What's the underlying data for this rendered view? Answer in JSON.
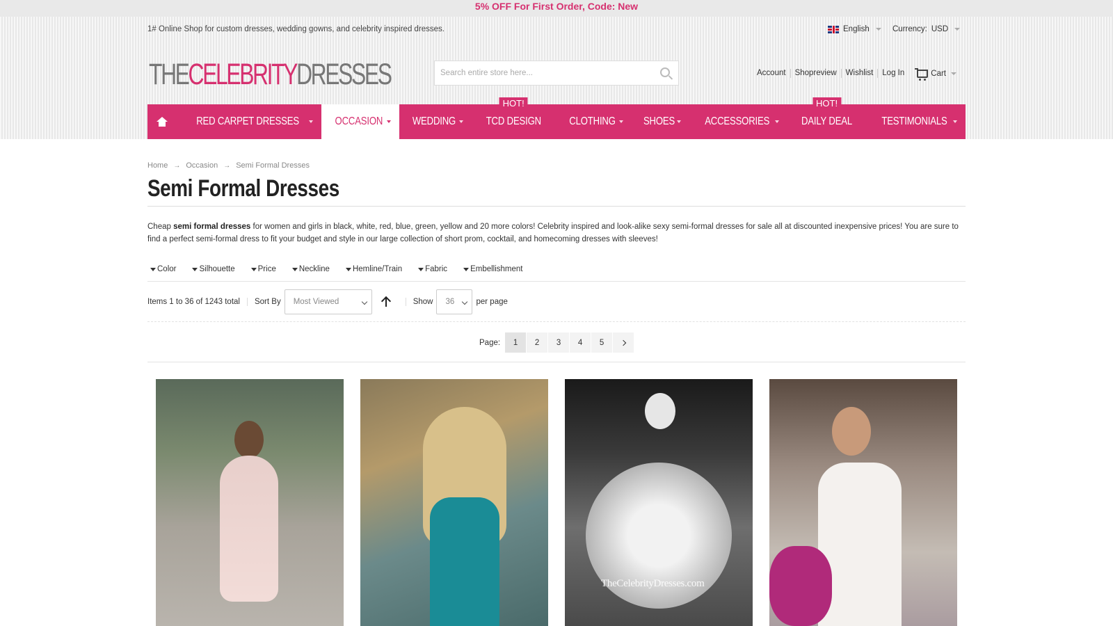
{
  "promo": "5% OFF For First Order, Code: New",
  "tagline": "1# Online Shop for custom dresses, wedding gowns, and celebrity inspired dresses.",
  "language": "English",
  "currency": {
    "label": "Currency:",
    "value": "USD"
  },
  "logo": {
    "part1": "THE",
    "part2": "CELEBRITY",
    "part3": "DRESSES"
  },
  "search": {
    "placeholder": "Search entire store here..."
  },
  "toplinks": [
    "Account",
    "Shopreview",
    "Wishlist",
    "Log In"
  ],
  "cart_label": "Cart",
  "nav": {
    "items": [
      {
        "label": "RED CARPET DRESSES"
      },
      {
        "label": "OCCASION"
      },
      {
        "label": "WEDDING"
      },
      {
        "label": "TCD DESIGN",
        "badge": "Hot!"
      },
      {
        "label": "CLOTHING"
      },
      {
        "label": "SHOES"
      },
      {
        "label": "ACCESSORIES"
      },
      {
        "label": "DAILY DEAL",
        "badge": "Hot!"
      },
      {
        "label": "TESTIMONIALS"
      }
    ]
  },
  "breadcrumb": [
    "Home",
    "Occasion",
    "Semi Formal Dresses"
  ],
  "page_title": "Semi Formal Dresses",
  "description": {
    "pre": "Cheap ",
    "bold": "semi formal dresses",
    "post": " for women and girls in black, white, red, blue, green, yellow and 20 more colors! Celebrity inspired and look-alike sexy semi-formal dresses for sale all at discounted inexpensive prices! You are sure to find a perfect semi-formal dress to fit your budget and style in our large collection of short prom, cocktail, and homecoming dresses with sleeves!"
  },
  "filters": [
    "Color",
    "Silhouette",
    "Price",
    "Neckline",
    "Hemline/Train",
    "Fabric",
    "Embellishment"
  ],
  "toolbar": {
    "items_text": "Items 1 to 36 of 1243 total",
    "sort_label": "Sort By",
    "sort_value": "Most Viewed",
    "show_label": "Show",
    "show_value": "36",
    "per_page": "per page"
  },
  "pager": {
    "label": "Page:",
    "pages": [
      "1",
      "2",
      "3",
      "4",
      "5"
    ],
    "current": "1"
  },
  "products": [
    {
      "watermark": ""
    },
    {
      "watermark": ""
    },
    {
      "watermark": "TheCelebrityDresses.com"
    },
    {
      "watermark": ""
    }
  ],
  "colors": {
    "accent": "#d6306f",
    "header_bg": "#eeeeee"
  }
}
